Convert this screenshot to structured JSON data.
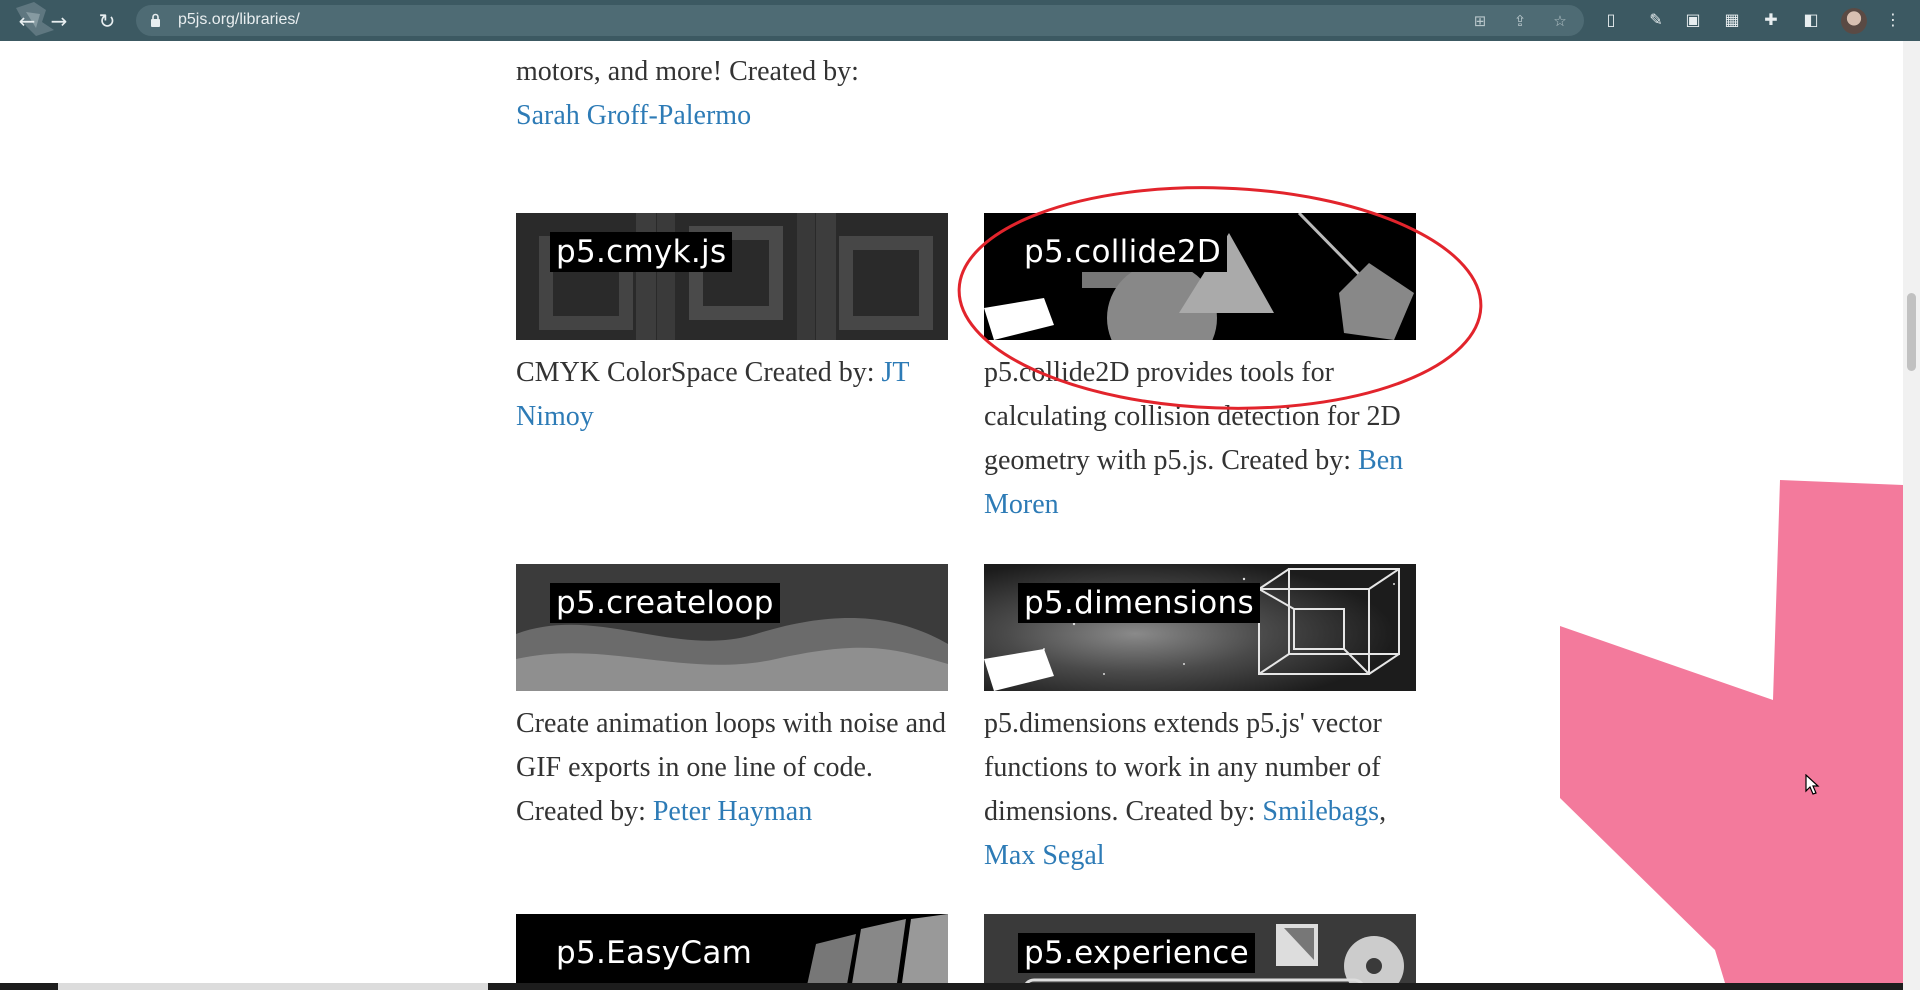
{
  "browser": {
    "url": "p5js.org/libraries/",
    "back_icon": "back-arrow-icon",
    "reload_icon": "reload-icon"
  },
  "intro": {
    "text_before": "motors, and more! Created by:",
    "author": "Sarah Groff-Palermo"
  },
  "libraries": [
    {
      "name": "p5.cmyk.js",
      "description": "CMYK ColorSpace Created by: ",
      "authors": [
        "JT Nimoy"
      ]
    },
    {
      "name": "p5.collide2D",
      "description": "p5.collide2D provides tools for calculating collision detection for 2D geometry with p5.js. Created by: ",
      "authors": [
        "Ben Moren"
      ]
    },
    {
      "name": "p5.createloop",
      "description": "Create animation loops with noise and GIF exports in one line of code. Created by: ",
      "authors": [
        "Peter Hayman"
      ]
    },
    {
      "name": "p5.dimensions",
      "description": "p5.dimensions extends p5.js' vector functions to work in any number of dimensions. Created by: ",
      "authors": [
        "Smilebags",
        "Max Segal"
      ],
      "author_separator": ","
    },
    {
      "name": "p5.EasyCam"
    },
    {
      "name": "p5.experience"
    }
  ],
  "colors": {
    "link": "#2d7bb6",
    "text": "#333333",
    "chrome": "#3c5962",
    "accent_pink": "#f37a9c",
    "annotation_red": "#e2242c"
  }
}
